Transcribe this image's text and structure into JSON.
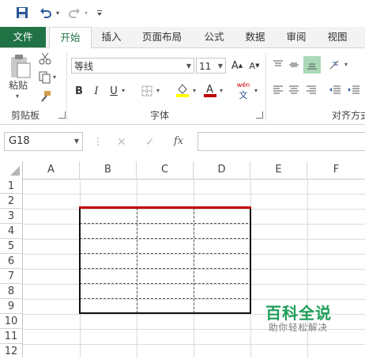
{
  "ribbon_tabs": [
    {
      "label": "文件"
    },
    {
      "label": "开始"
    },
    {
      "label": "插入"
    },
    {
      "label": "页面布局"
    },
    {
      "label": "公式"
    },
    {
      "label": "数据"
    },
    {
      "label": "审阅"
    },
    {
      "label": "视图"
    }
  ],
  "clipboard": {
    "paste_label": "粘贴",
    "group_label": "剪贴板"
  },
  "font": {
    "name": "等线",
    "size": "11",
    "group_label": "字体",
    "phonetic": "wén"
  },
  "alignment": {
    "group_label": "对齐方式"
  },
  "formula_bar": {
    "name_box": "G18",
    "fx": "fx",
    "value": ""
  },
  "columns": [
    "A",
    "B",
    "C",
    "D",
    "E",
    "F"
  ],
  "rows": [
    "1",
    "2",
    "3",
    "4",
    "5",
    "6",
    "7",
    "8",
    "9",
    "10",
    "11",
    "12"
  ],
  "colors": {
    "accent": "#217346",
    "font_color": "#c00000",
    "fill_color": "#ffff00",
    "top_border": "#c00000"
  },
  "watermark": {
    "title": "百科全说",
    "subtitle": "助你轻松解决"
  }
}
